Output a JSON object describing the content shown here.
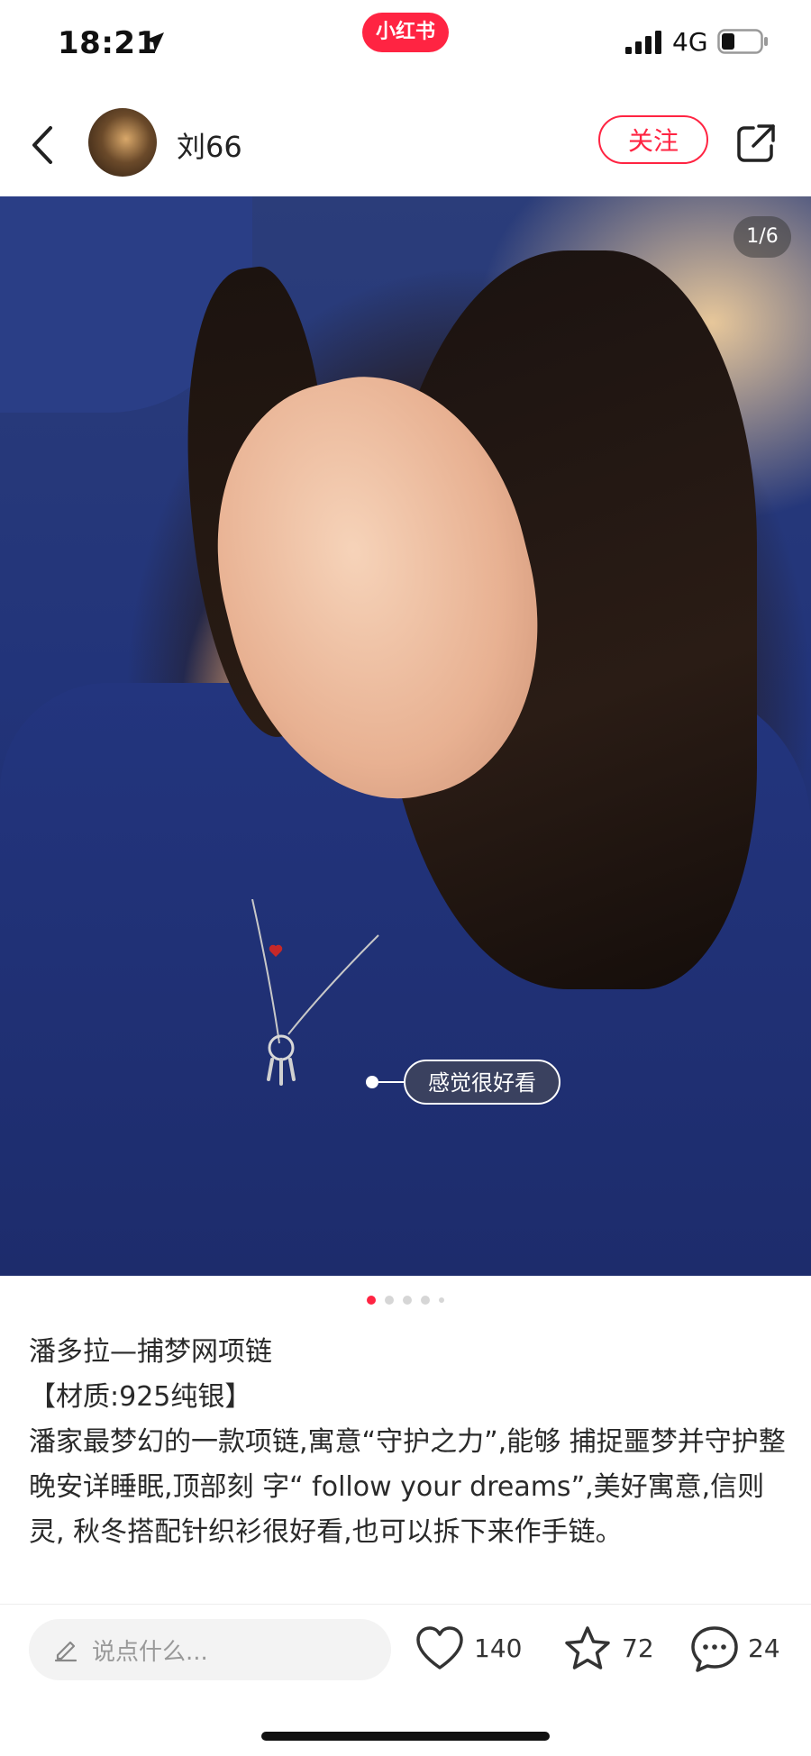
{
  "status_bar": {
    "time": "18:21",
    "network": "4G",
    "app_badge": "小红书"
  },
  "header": {
    "username": "刘66",
    "follow_label": "关注"
  },
  "photo": {
    "counter": "1/6",
    "tag_label": "感觉很好看",
    "page_dots": 5,
    "active_dot": 0
  },
  "post": {
    "title": "潘多拉—捕梦网项链",
    "material": "【材质:925纯银】",
    "body": "潘家最梦幻的一款项链,寓意“守护之力”,能够 捕捉噩梦并守护整晚安详睡眠,顶部刻 字“ follow your dreams”,美好寓意,信则灵, 秋冬搭配针织衫很好看,也可以拆下来作手链。"
  },
  "bottom_bar": {
    "comment_placeholder": "说点什么...",
    "like_count": "140",
    "collect_count": "72",
    "comment_count": "24"
  },
  "colors": {
    "brand": "#ff2442",
    "text": "#2a2a2a",
    "muted": "#999999"
  }
}
